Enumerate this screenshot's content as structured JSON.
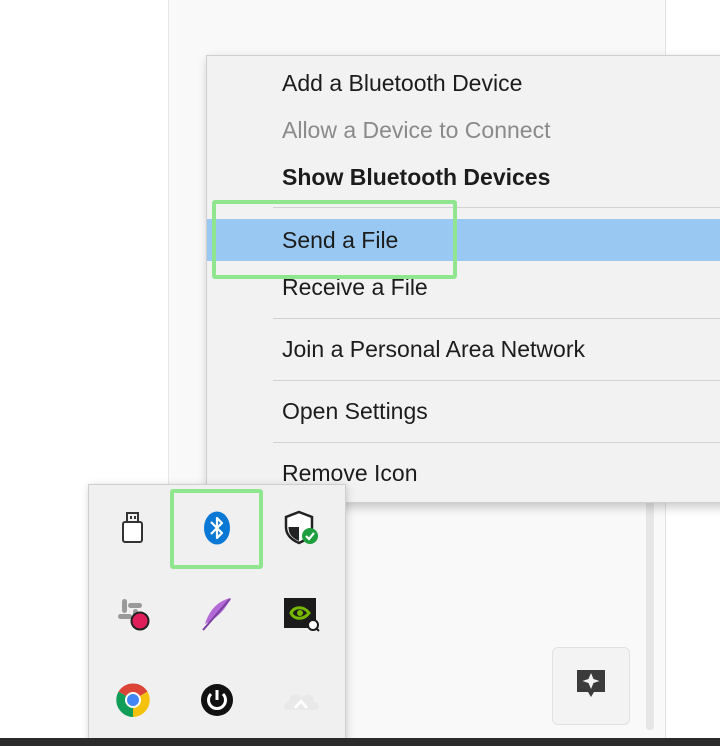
{
  "context_menu": {
    "items": [
      {
        "label": "Add a Bluetooth Device",
        "state": "normal"
      },
      {
        "label": "Allow a Device to Connect",
        "state": "disabled"
      },
      {
        "label": "Show Bluetooth Devices",
        "state": "default-bold"
      },
      {
        "label": "Send a File",
        "state": "highlighted"
      },
      {
        "label": "Receive a File",
        "state": "normal"
      },
      {
        "label": "Join a Personal Area Network",
        "state": "normal"
      },
      {
        "label": "Open Settings",
        "state": "normal"
      },
      {
        "label": "Remove Icon",
        "state": "normal"
      }
    ]
  },
  "tray_overflow": {
    "icons": [
      {
        "name": "usb-drive-icon"
      },
      {
        "name": "bluetooth-icon",
        "highlighted": true
      },
      {
        "name": "windows-security-icon"
      },
      {
        "name": "slack-icon"
      },
      {
        "name": "feather-icon"
      },
      {
        "name": "nvidia-icon"
      },
      {
        "name": "chrome-icon"
      },
      {
        "name": "power-icon"
      },
      {
        "name": "cloud-app-icon"
      }
    ]
  },
  "colors": {
    "highlight": "#99c9f2",
    "guide_green": "#8fe68f",
    "bluetooth_blue": "#0a78d4",
    "disabled_text": "#8a8a8a"
  }
}
